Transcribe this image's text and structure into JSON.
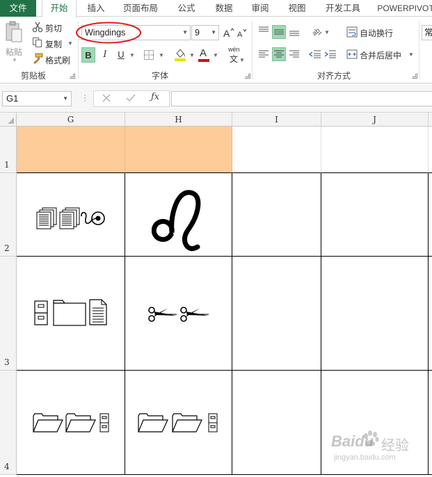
{
  "tabs": [
    {
      "label": "文件"
    },
    {
      "label": "开始"
    },
    {
      "label": "插入"
    },
    {
      "label": "页面布局"
    },
    {
      "label": "公式"
    },
    {
      "label": "数据"
    },
    {
      "label": "审阅"
    },
    {
      "label": "视图"
    },
    {
      "label": "开发工具"
    },
    {
      "label": "POWERPIVOT"
    }
  ],
  "clipboard": {
    "paste_label": "粘贴",
    "cut_label": "剪切",
    "copy_label": "复制",
    "format_painter_label": "格式刷",
    "group_label": "剪贴板"
  },
  "font": {
    "name": "Wingdings",
    "size": "9",
    "bold": "B",
    "italic": "I",
    "underline": "U",
    "font_color_glyph": "A",
    "phonetic_glyph": "wén",
    "phonetic_sub": "文",
    "group_label": "字体",
    "highlight_color": "#e4e400",
    "font_color": "#e00000"
  },
  "alignment": {
    "wrap_text_label": "自动换行",
    "merge_center_label": "合并后居中",
    "group_label": "对齐方式"
  },
  "number": {
    "format_label": "常"
  },
  "formula_bar": {
    "name_box": "G1",
    "formula": ""
  },
  "grid": {
    "columns": [
      "G",
      "H",
      "I",
      "J"
    ],
    "rows": [
      "1",
      "2",
      "3",
      "4"
    ],
    "header_fill": "#fdcc99",
    "cells": {
      "G2": [
        "documents-icon",
        "documents-icon",
        "tape-reel-icon"
      ],
      "H2": [
        "leo-sign-icon"
      ],
      "G3": [
        "file-cabinet-icon",
        "folder-icon",
        "page-icon"
      ],
      "H3": [
        "scissors-icon",
        "scissors-icon"
      ],
      "G4": [
        "open-folder-icon",
        "open-folder-icon",
        "file-cabinet-icon"
      ],
      "H4": [
        "open-folder-icon",
        "open-folder-icon",
        "file-cabinet-icon"
      ]
    }
  },
  "watermark": {
    "brand": "Baidu",
    "brand_suffix": "经验",
    "url": "jingyan.baidu.com"
  },
  "colors": {
    "accent": "#217346",
    "annotation": "#e02020"
  }
}
